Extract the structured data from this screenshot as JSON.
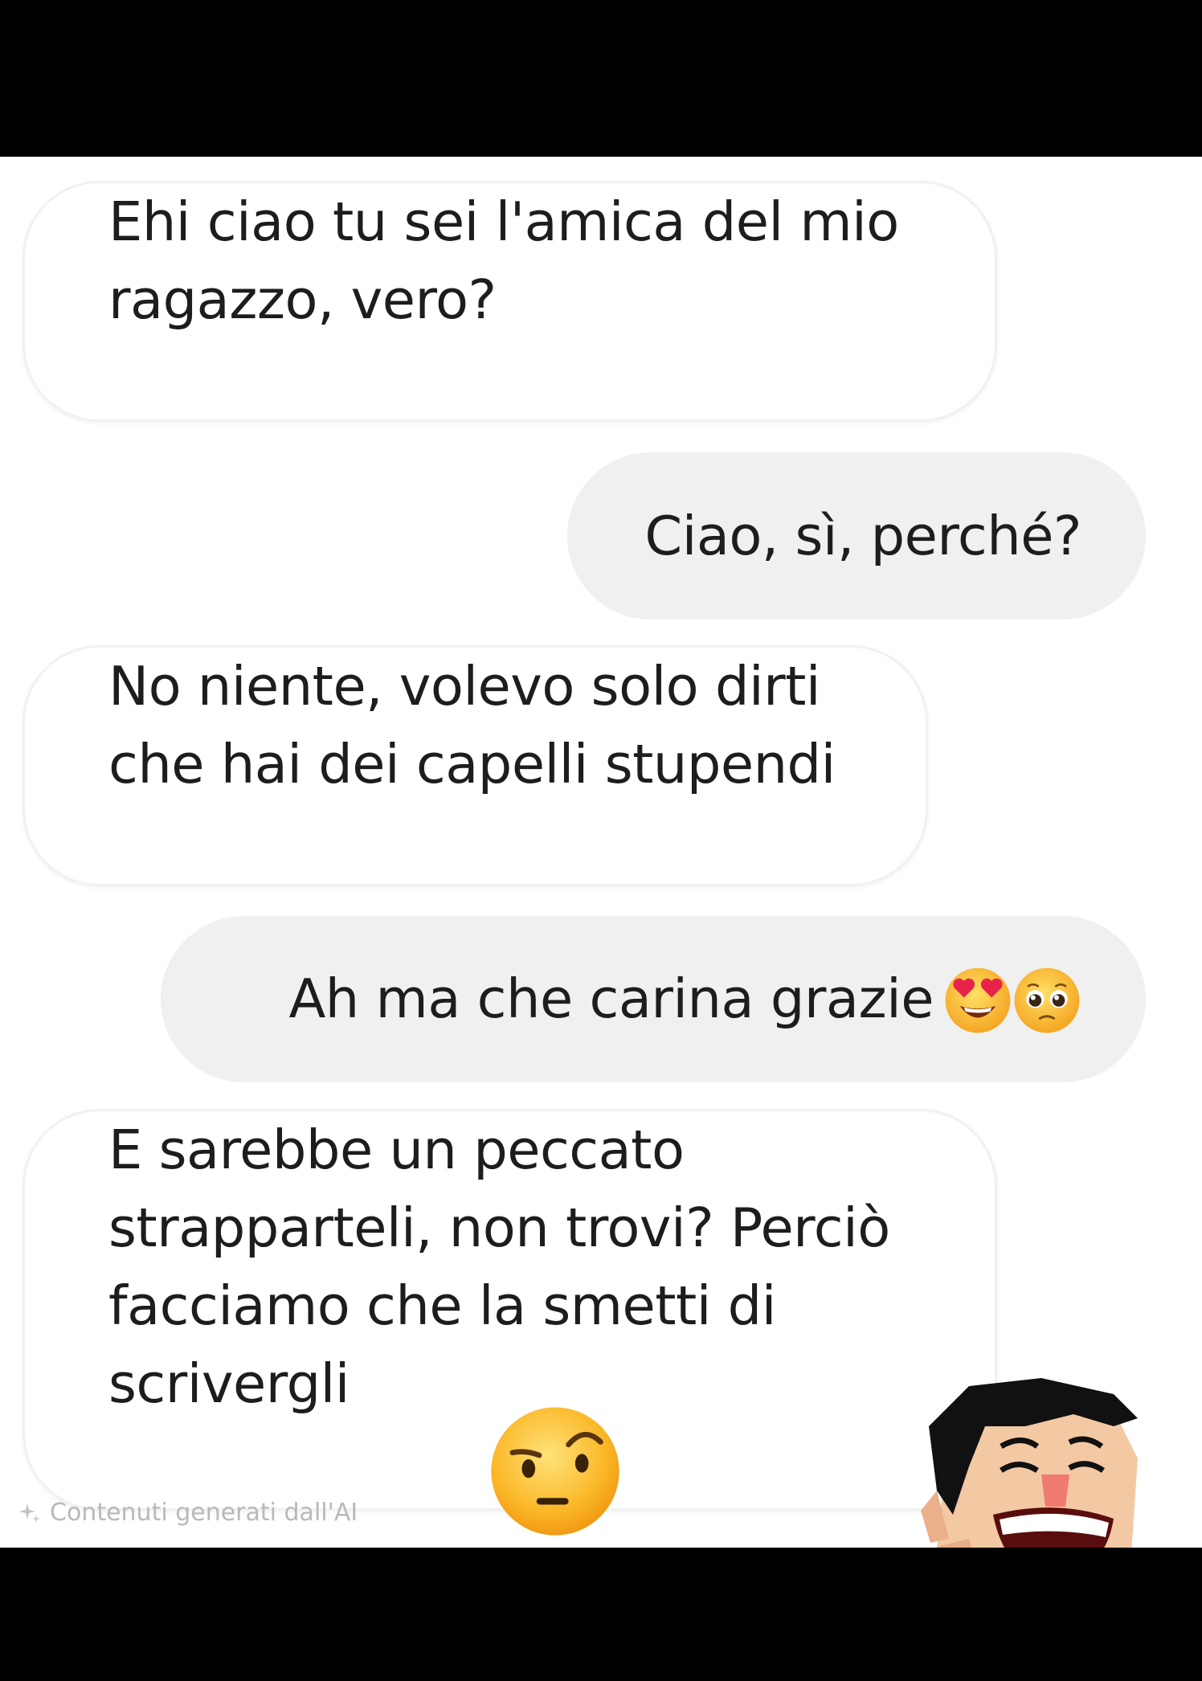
{
  "messages": [
    {
      "side": "in",
      "text": "Ehi ciao tu sei l'amica del mio ragazzo, vero?"
    },
    {
      "side": "out",
      "text": "Ciao, sì, perché?"
    },
    {
      "side": "in",
      "text": "No niente, volevo solo dirti che hai dei capelli stupendi"
    },
    {
      "side": "out",
      "text": "Ah ma che carina grazie",
      "emojis": [
        "heart-eyes-emoji",
        "pleading-face-emoji"
      ]
    },
    {
      "side": "in",
      "text": "E sarebbe un peccato strapparteli, non trovi? Perciò facciamo che la smetti di scrivergli"
    }
  ],
  "ai_notice": "Contenuti generati dall'AI",
  "stickers": [
    "raised-eyebrow-emoji",
    "laughing-cartoon-man"
  ],
  "colors": {
    "incoming_bubble": "#ffffff",
    "outgoing_bubble": "#f0f0f0",
    "text": "#1d1d1d",
    "frame": "#000000",
    "emoji_yellow": "#ffcc33",
    "shirt_red": "#e32020"
  }
}
